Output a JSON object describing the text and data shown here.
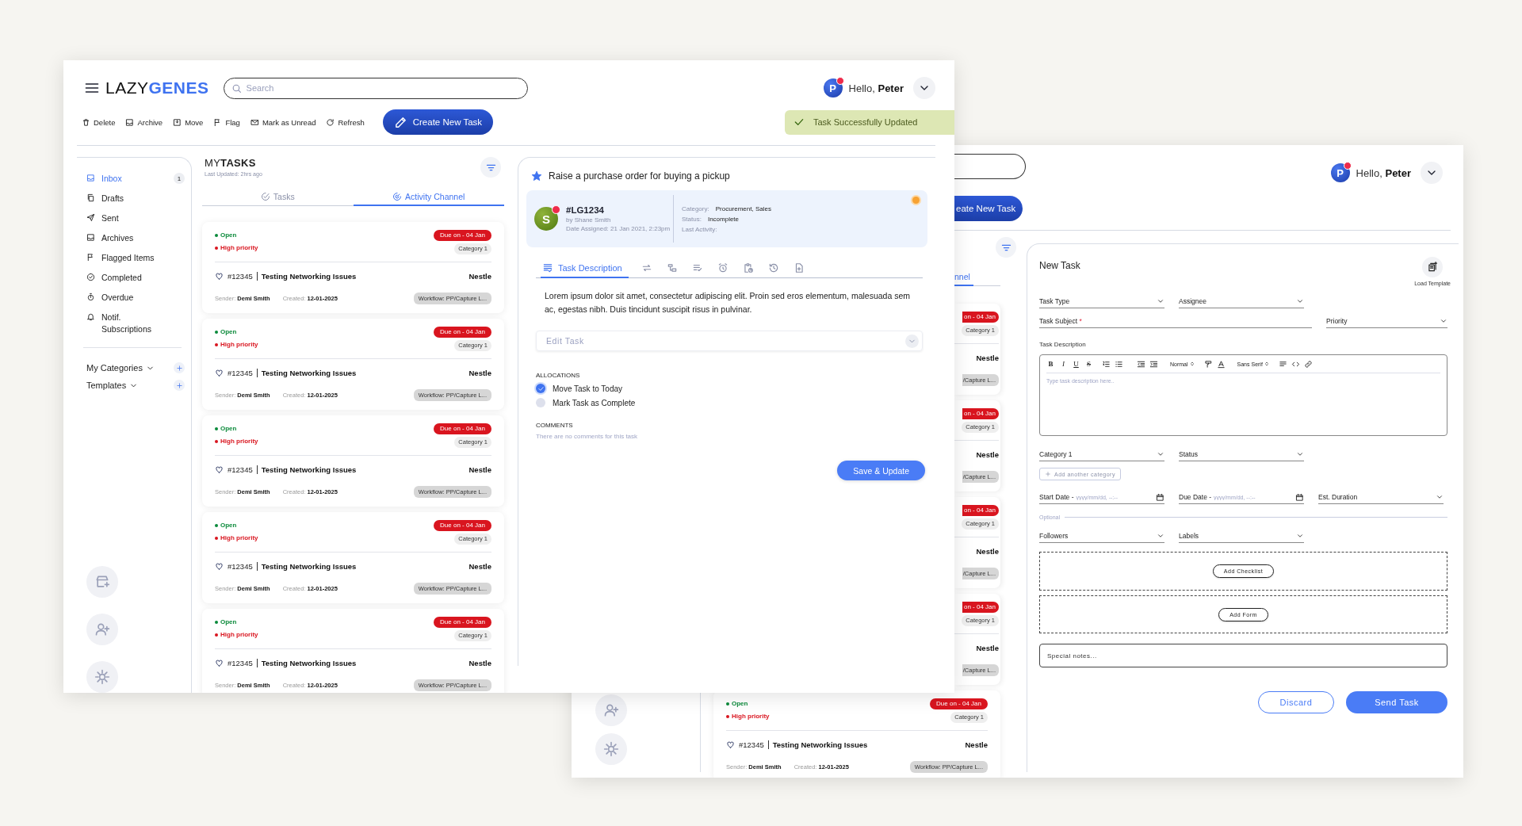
{
  "front_window": {
    "logo": "LAZY**GENES**",
    "search": {
      "placeholder": "Search"
    },
    "user": {
      "initial": "P",
      "greeting": "Hello, **Peter**"
    },
    "toolbar": [
      "Delete",
      "Archive",
      "Move",
      "Flag",
      "Mark as Unread",
      "Refresh"
    ],
    "create_button": "Create New Task",
    "toast": "Task Successfully Updated",
    "sidebar": {
      "items": [
        {
          "label": "Inbox",
          "count": "1",
          "selected": true
        },
        {
          "label": "Drafts",
          "selected": false
        },
        {
          "label": "Sent",
          "selected": false
        },
        {
          "label": "Archives",
          "selected": false
        },
        {
          "label": "Flagged Items",
          "selected": false
        },
        {
          "label": "Completed",
          "selected": false
        },
        {
          "label": "Overdue",
          "selected": false
        },
        {
          "label": "Notif. Subscriptions",
          "selected": false
        }
      ],
      "groups": [
        "My Categories",
        "Templates"
      ]
    },
    "task_list": {
      "title": "MY**TASKS**",
      "updated": "Last Updated: 2hrs ago",
      "tabs": [
        {
          "label": "Tasks",
          "selected": false
        },
        {
          "label": "Activity Channel",
          "selected": true
        }
      ],
      "cards": [
        {
          "status": "Open",
          "priority": "High priority",
          "due": "Due on - 04 Jan",
          "category": "Category 1",
          "id": "#12345",
          "title": "Testing Networking Issues",
          "client": "Nestle",
          "sender": "Sender: **Demi Smith**",
          "created": "Created: **12-01-2025**",
          "workflow": "Workflow: PP/Capture L..."
        },
        {
          "status": "Open",
          "priority": "High priority",
          "due": "Due on - 04 Jan",
          "category": "Category 1",
          "id": "#12345",
          "title": "Testing Networking Issues",
          "client": "Nestle",
          "sender": "Sender: **Demi Smith**",
          "created": "Created: **12-01-2025**",
          "workflow": "Workflow: PP/Capture L..."
        },
        {
          "status": "Open",
          "priority": "High priority",
          "due": "Due on - 04 Jan",
          "category": "Category 1",
          "id": "#12345",
          "title": "Testing Networking Issues",
          "client": "Nestle",
          "sender": "Sender: **Demi Smith**",
          "created": "Created: **12-01-2025**",
          "workflow": "Workflow: PP/Capture L..."
        },
        {
          "status": "Open",
          "priority": "High priority",
          "due": "Due on - 04 Jan",
          "category": "Category 1",
          "id": "#12345",
          "title": "Testing Networking Issues",
          "client": "Nestle",
          "sender": "Sender: **Demi Smith**",
          "created": "Created: **12-01-2025**",
          "workflow": "Workflow: PP/Capture L..."
        },
        {
          "status": "Open",
          "priority": "High priority",
          "due": "Due on - 04 Jan",
          "category": "Category 1",
          "id": "#12345",
          "title": "Testing Networking Issues",
          "client": "Nestle",
          "sender": "Sender: **Demi Smith**",
          "created": "Created: **12-01-2025**",
          "workflow": "Workflow: PP/Capture L..."
        }
      ]
    },
    "detail": {
      "title": "Raise a purchase order for buying a pickup",
      "starred": true,
      "task": {
        "avatar": "S",
        "id": "#LG1234",
        "by": "by Shane Smith",
        "assigned": "Date Assigned: 21 Jan 2021, 2:23pm",
        "meta": [
          {
            "label": "Category:",
            "value": "Procurement, Sales"
          },
          {
            "label": "Status:",
            "value": "Incomplete"
          },
          {
            "label": "Last Activity:"
          }
        ]
      },
      "tabs": [
        {
          "label": "Task Description",
          "selected": true
        },
        {
          "selected": false
        },
        {
          "selected": false
        },
        {
          "selected": false
        },
        {
          "selected": false
        },
        {
          "selected": false
        },
        {
          "selected": false
        },
        {
          "selected": false
        }
      ],
      "description": "Lorem ipsum dolor sit amet, consectetur adipiscing elit. Proin sed eros elementum, malesuada sem ac, egestas nibh. Duis tincidunt suscipit risus in pulvinar.",
      "edit_task": "Edit Task",
      "allocations_title": "ALLOCATIONS",
      "allocations": [
        {
          "label": "Move Task to Today",
          "checked": true
        },
        {
          "label": "Mark Task as Complete",
          "checked": false
        }
      ],
      "comments_title": "COMMENTS",
      "comments_empty": "There are no comments for this task",
      "save_button": "Save & Update"
    }
  },
  "back_window": {
    "create_button": "eate New Task",
    "user": {
      "initial": "P",
      "greeting": "Hello, **Peter**"
    },
    "list_tab": {
      "label": "nnel",
      "selected": true
    },
    "cards": [
      {
        "due": "on - 04 Jan",
        "category": "Category 1",
        "client": "Nestle",
        "workflow": "/Capture L..."
      },
      {
        "due": "on - 04 Jan",
        "category": "Category 1",
        "client": "Nestle",
        "workflow": "/Capture L..."
      },
      {
        "due": "on - 04 Jan",
        "category": "Category 1",
        "client": "Nestle",
        "workflow": "/Capture L..."
      },
      {
        "due": "on - 04 Jan",
        "category": "Category 1",
        "client": "Nestle",
        "workflow": "/Capture L..."
      },
      {
        "status": "Open",
        "priority": "High priority",
        "due": "Due on - 04 Jan",
        "category": "Category 1",
        "id": "#12345",
        "title": "Testing Networking Issues",
        "client": "Nestle",
        "sender": "Sender: **Demi Smith**",
        "created": "Created: **12-01-2025**",
        "workflow": "Workflow: PP/Capture L..."
      }
    ],
    "new_task": {
      "title": "New Task",
      "load_template": "Load Template",
      "task_type": {
        "label": "Task Type"
      },
      "assignee": {
        "label": "Assignee"
      },
      "task_subject": {
        "label": "Task Subject",
        "required_mark": "*"
      },
      "priority": {
        "label": "Priority"
      },
      "description_label": "Task Description",
      "editor": {
        "format_buttons": [
          "B",
          "I",
          "U",
          "S"
        ],
        "heading_select": "Normal",
        "font_select": "Sans Serif",
        "placeholder": "Type task description here.."
      },
      "category": {
        "label": "Category 1"
      },
      "status": {
        "label": "Status"
      },
      "add_category": "Add another category",
      "start_date": {
        "label": "Start Date -",
        "placeholder": "yyyy/mm/dd, --:--"
      },
      "due_date": {
        "label": "Due Date -",
        "placeholder": "yyyy/mm/dd, --:--"
      },
      "est_duration": {
        "label": "Est. Duration"
      },
      "optional_label": "Optional",
      "followers": {
        "label": "Followers"
      },
      "labels": {
        "label": "Labels"
      },
      "add_checklist": "Add Checklist",
      "add_form": "Add Form",
      "special_notes": {
        "placeholder": "Special notes..."
      },
      "discard": "Discard",
      "send": "Send Task"
    }
  }
}
